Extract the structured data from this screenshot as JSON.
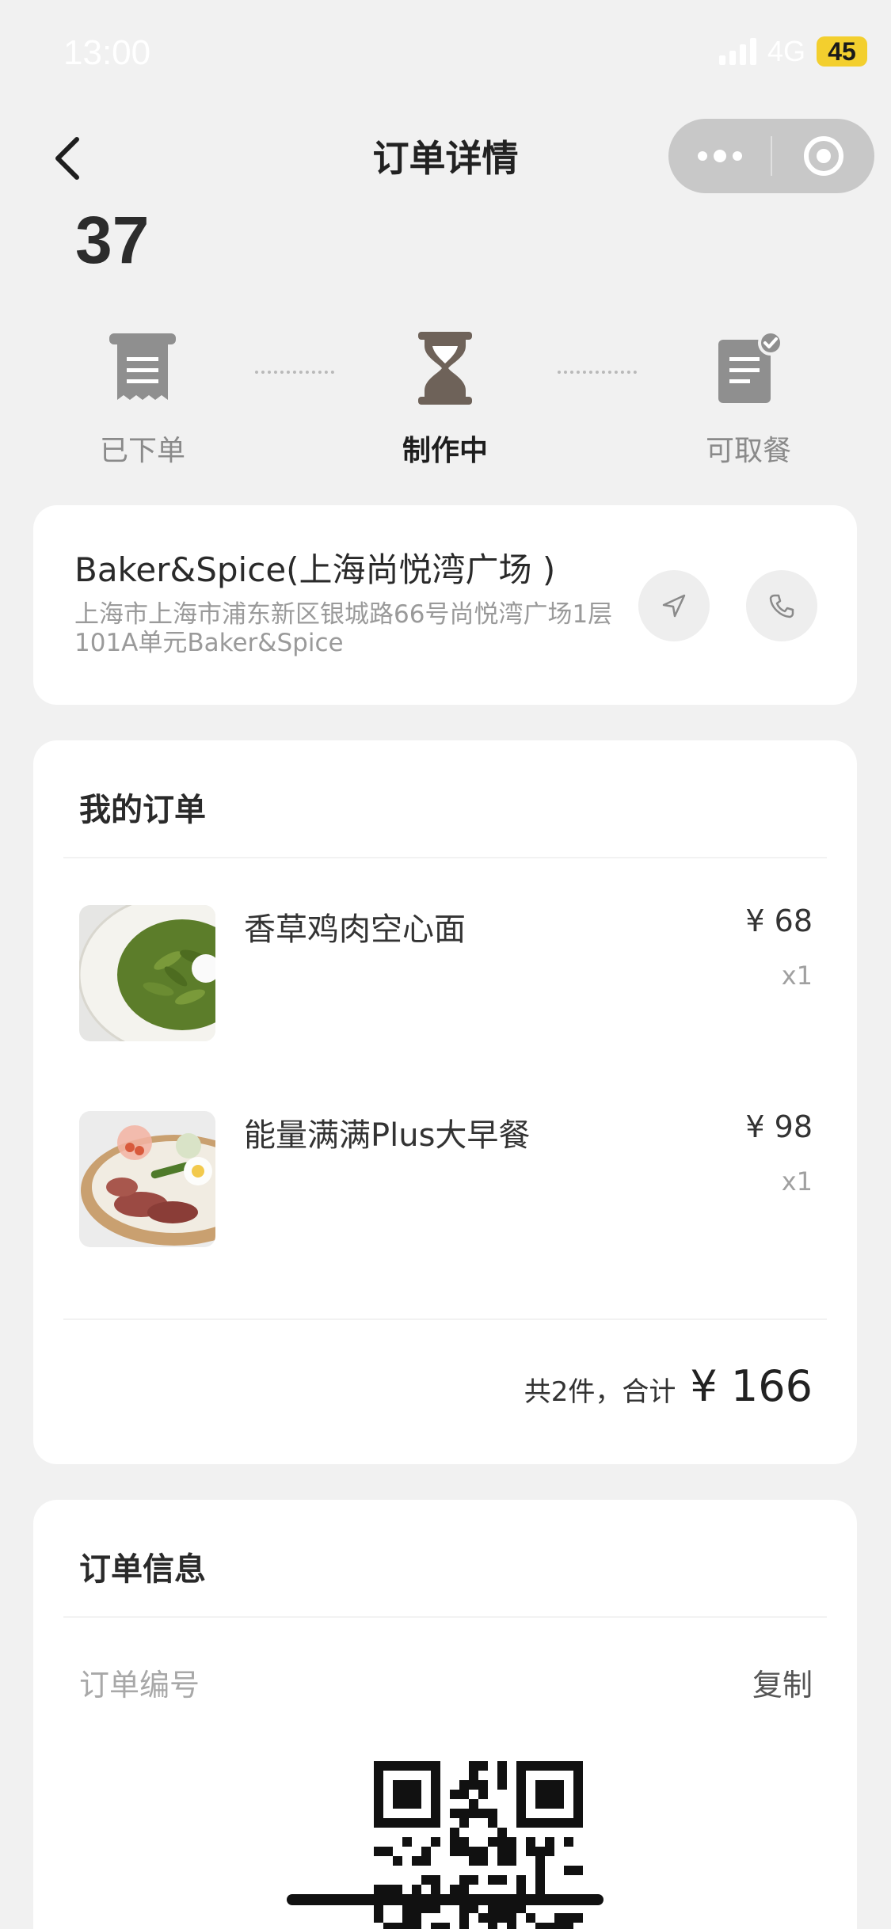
{
  "status_bar": {
    "time": "13:00",
    "network": "4G",
    "battery": "45"
  },
  "nav": {
    "title": "订单详情"
  },
  "order": {
    "pickup_number": "37"
  },
  "progress": {
    "steps": [
      {
        "label": "已下单",
        "state": "done"
      },
      {
        "label": "制作中",
        "state": "active"
      },
      {
        "label": "可取餐",
        "state": "pending"
      }
    ]
  },
  "store": {
    "name": "Baker&Spice(上海尚悦湾广场 )",
    "address": "上海市上海市浦东新区银城路66号尚悦湾广场1层101A单元Baker&Spice"
  },
  "my_order": {
    "title": "我的订单",
    "items": [
      {
        "name": "香草鸡肉空心面",
        "price": "¥ 68",
        "qty": "x1",
        "image": "pesto-pasta-dish"
      },
      {
        "name": "能量满满Plus大早餐",
        "price": "¥ 98",
        "qty": "x1",
        "image": "breakfast-plate"
      }
    ],
    "summary_label": "共2件，合计",
    "total": "¥ 166"
  },
  "order_info": {
    "title": "订单信息",
    "number_label": "订单编号",
    "copy_label": "复制"
  },
  "colors": {
    "background": "#f1f1f1",
    "card": "#ffffff",
    "active_icon": "#6e6259",
    "inactive_icon": "#8f8f8f",
    "battery": "#f3cf2e"
  }
}
